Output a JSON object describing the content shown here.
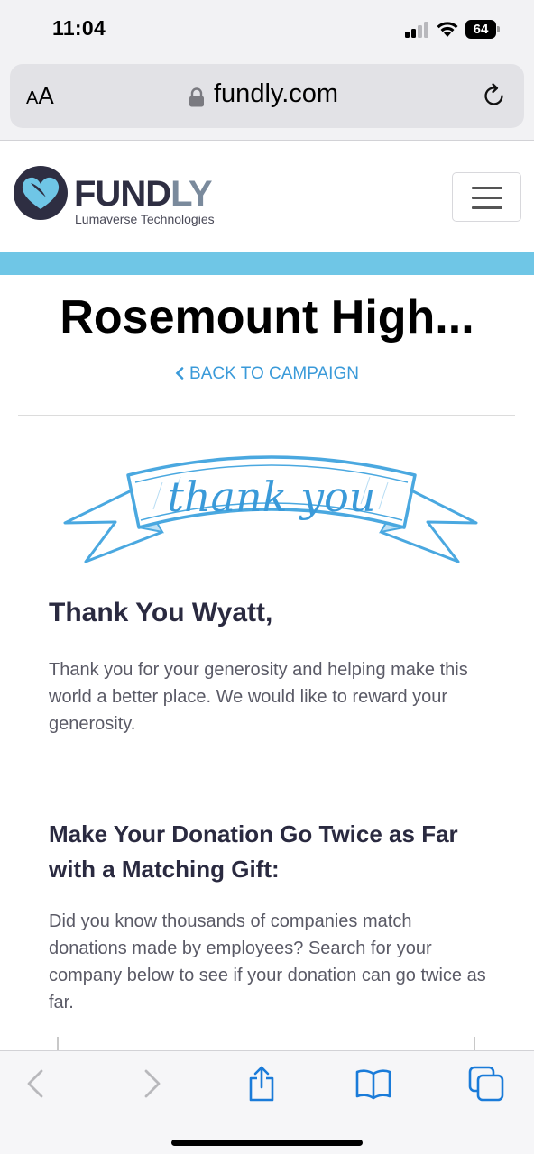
{
  "status_bar": {
    "time": "11:04",
    "battery": "64"
  },
  "browser": {
    "text_size_label_small": "A",
    "text_size_label_large": "A",
    "url": "fundly.com"
  },
  "site": {
    "logo_part1": "FUND",
    "logo_part2": "LY",
    "tagline": "Lumaverse Technologies",
    "brand_colors": {
      "navy": "#2e2e42",
      "gray": "#7a8a9c",
      "heart_blue": "#6fc6e6",
      "band": "#6fc6e6"
    }
  },
  "campaign": {
    "title": "Rosemount High...",
    "back_link": "BACK TO CAMPAIGN"
  },
  "banner_text": "thank you",
  "thanks": {
    "heading": "Thank You Wyatt,",
    "body": "Thank you for your generosity and helping make this world a better place. We would like to reward your generosity."
  },
  "matching": {
    "heading": "Make Your Donation Go Twice as Far with a Matching Gift:",
    "body": "Did you know thousands of companies match donations made by employees? Search for your company below to see if your donation can go twice as far."
  },
  "toolbar": {
    "icons": [
      "back-icon",
      "forward-icon",
      "share-icon",
      "bookmarks-icon",
      "tabs-icon"
    ],
    "accent": "#1a7bd9"
  }
}
